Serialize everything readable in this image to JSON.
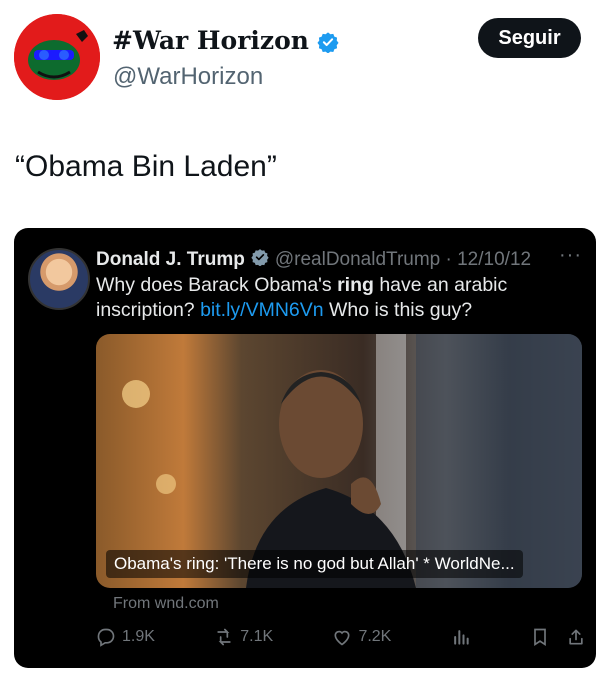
{
  "header": {
    "display_name": "#War Horizon",
    "handle": "@WarHorizon",
    "follow_label": "Seguir"
  },
  "tweet": {
    "text": "“Obama Bin Laden”"
  },
  "quoted": {
    "name": "Donald J. Trump",
    "handle_date": "@realDonaldTrump · 12/10/12",
    "more": "···",
    "body_before": "Why does Barack Obama's ",
    "body_bold": "ring",
    "body_after": " have an arabic inscription? ",
    "link": "bit.ly/VMN6Vn",
    "body_end": " Who is this guy?",
    "media_caption": "Obama's ring: 'There is no god but Allah' * WorldNe...",
    "from_text": "From wnd.com",
    "stats": {
      "replies": "1.9K",
      "retweets": "7.1K",
      "likes": "7.2K"
    }
  },
  "colors": {
    "accent": "#1d9bf0",
    "verified": "#1d9bf0",
    "avatar_bg": "#e21b1b"
  }
}
